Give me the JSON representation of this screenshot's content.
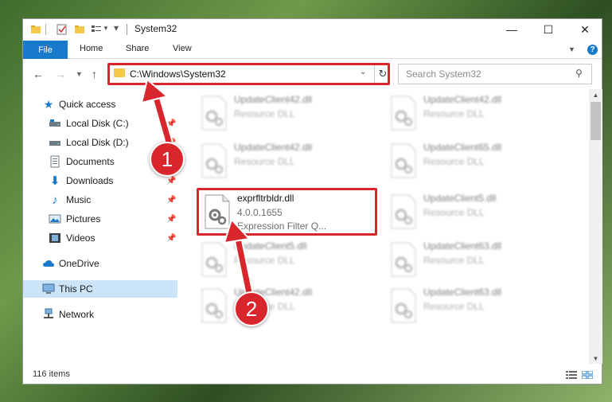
{
  "window": {
    "title": "System32"
  },
  "ribbon": {
    "tabs": [
      "File",
      "Home",
      "Share",
      "View"
    ]
  },
  "address": {
    "path": "C:\\Windows\\System32"
  },
  "search": {
    "placeholder": "Search System32"
  },
  "sidebar": {
    "items": [
      {
        "label": "Quick access",
        "icon": "star-icon",
        "pinned": false
      },
      {
        "label": "Local Disk (C:)",
        "icon": "drive-icon",
        "pinned": true
      },
      {
        "label": "Local Disk (D:)",
        "icon": "drive-icon",
        "pinned": true
      },
      {
        "label": "Documents",
        "icon": "documents-icon",
        "pinned": true
      },
      {
        "label": "Downloads",
        "icon": "download-icon",
        "pinned": true
      },
      {
        "label": "Music",
        "icon": "music-icon",
        "pinned": true
      },
      {
        "label": "Pictures",
        "icon": "pictures-icon",
        "pinned": true
      },
      {
        "label": "Videos",
        "icon": "videos-icon",
        "pinned": true
      },
      {
        "label": "OneDrive",
        "icon": "cloud-icon",
        "pinned": false
      },
      {
        "label": "This PC",
        "icon": "computer-icon",
        "pinned": false,
        "selected": true
      },
      {
        "label": "Network",
        "icon": "network-icon",
        "pinned": false
      }
    ]
  },
  "files": [
    {
      "name": "UpdateClient42.dll",
      "line2": "Resource DLL",
      "line3": "",
      "blurred": true
    },
    {
      "name": "UpdateClient42.dll",
      "line2": "Resource DLL",
      "line3": "",
      "blurred": true
    },
    {
      "name": "UpdateClient42.dll",
      "line2": "Resource DLL",
      "line3": "",
      "blurred": true
    },
    {
      "name": "UpdateClient65.dll",
      "line2": "Resource DLL",
      "line3": "",
      "blurred": true
    },
    {
      "name": "exprfltrbldr.dll",
      "line2": "4.0.0.1655",
      "line3": "Expression Filter Q...",
      "blurred": false
    },
    {
      "name": "UpdateClient5.dll",
      "line2": "Resource DLL",
      "line3": "",
      "blurred": true
    },
    {
      "name": "UpdateClient5.dll",
      "line2": "Resource DLL",
      "line3": "",
      "blurred": true
    },
    {
      "name": "UpdateClient63.dll",
      "line2": "Resource DLL",
      "line3": "",
      "blurred": true
    },
    {
      "name": "UpdateClient42.dll",
      "line2": "Resource DLL",
      "line3": "",
      "blurred": true
    },
    {
      "name": "UpdateClient63.dll",
      "line2": "Resource DLL",
      "line3": "",
      "blurred": true
    }
  ],
  "status": {
    "count": "116 items"
  },
  "callouts": [
    "1",
    "2"
  ],
  "colors": {
    "accent": "#1979ca",
    "highlight": "#d9262c",
    "selected": "#cce4f7"
  }
}
